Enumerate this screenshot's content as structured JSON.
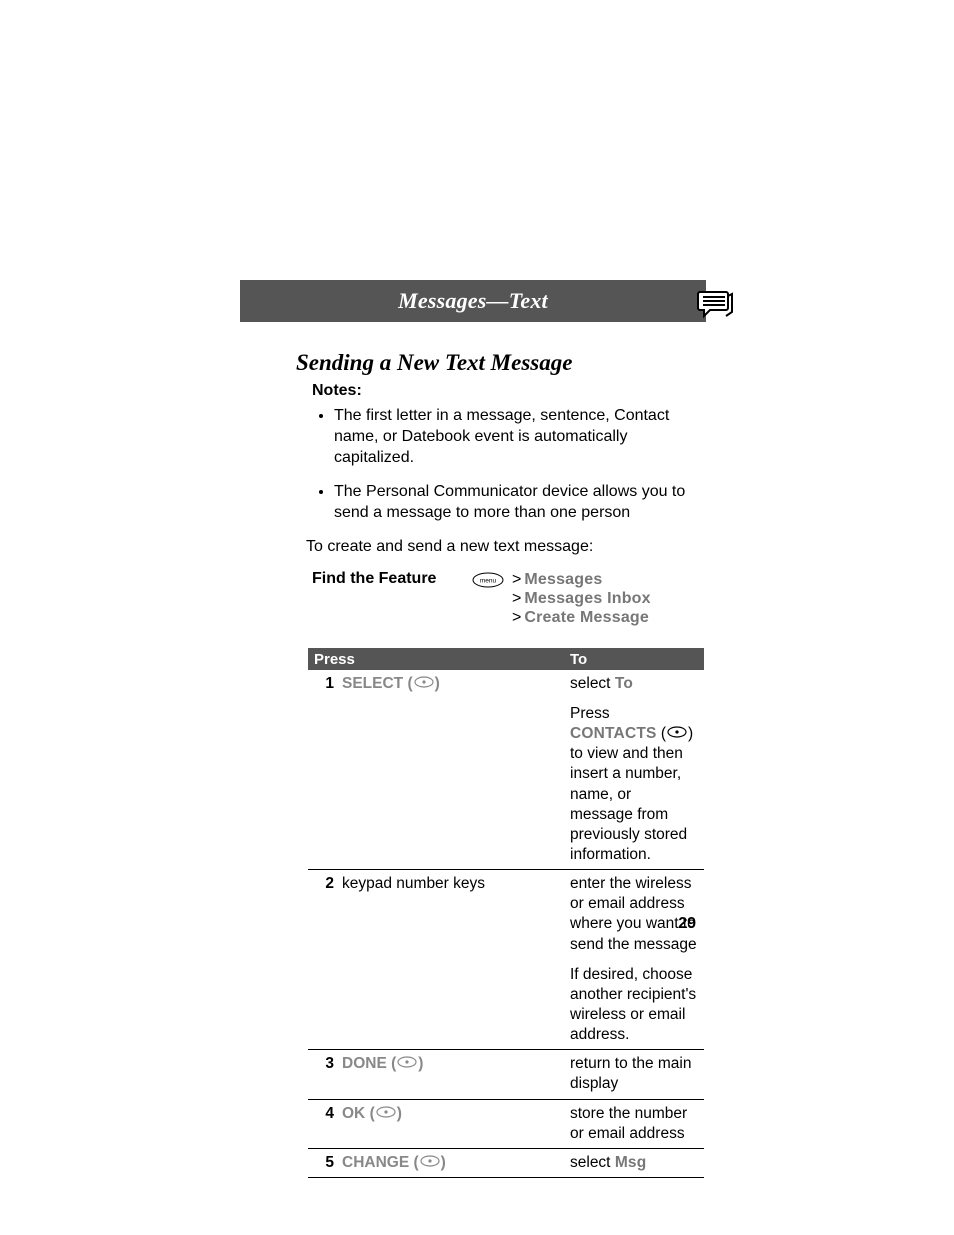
{
  "titlebar": "Messages—Text",
  "section_heading": "Sending a New Text Message",
  "notes_label": "Notes:",
  "notes": [
    "The first letter in a message, sentence, Contact name, or Datebook event is automatically capitalized.",
    "The Personal Communicator device allows you to send a message to more than one person"
  ],
  "lead": "To create and send a new text message:",
  "ftf_label": "Find the Feature",
  "ftf_path": {
    "l1": "Messages",
    "l2": "Messages Inbox",
    "l3": "Create Message"
  },
  "table": {
    "head_press": "Press",
    "head_to": "To",
    "rows": {
      "r1": {
        "num": "1",
        "press_label": "SELECT",
        "to_a_pre": "select ",
        "to_a_cmd": "To",
        "to_b_pre": "Press ",
        "to_b_cmd": "CONTACTS",
        "to_b_post": " to view and then insert a number, name, or message from previously stored information."
      },
      "r2": {
        "num": "2",
        "press_label": "keypad number keys",
        "to_a": "enter the wireless or email address where you want to send the message",
        "to_b": "If desired, choose another recipient's wireless or email address."
      },
      "r3": {
        "num": "3",
        "press_label": "DONE",
        "to": "return to the main display"
      },
      "r4": {
        "num": "4",
        "press_label": "OK",
        "to": "store the number or email address"
      },
      "r5": {
        "num": "5",
        "press_label": "CHANGE",
        "to_pre": "select ",
        "to_cmd": "Msg"
      }
    }
  },
  "page_number": "29"
}
